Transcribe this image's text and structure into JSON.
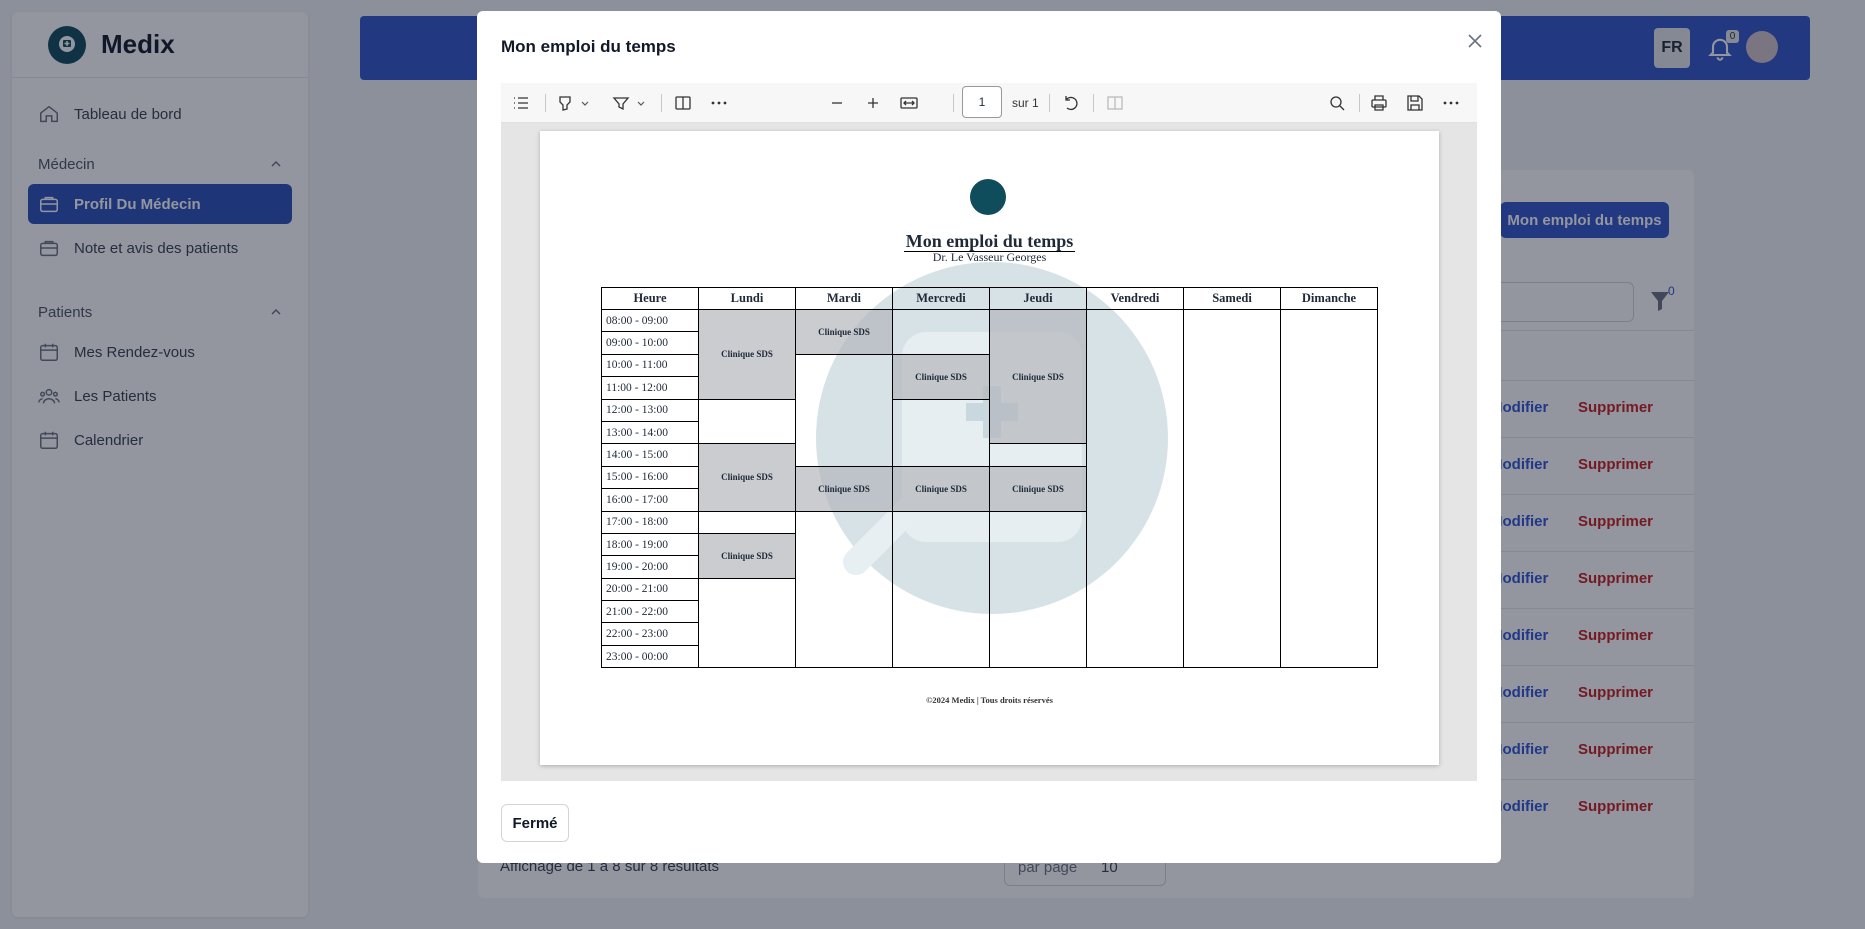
{
  "brand": {
    "name": "Medix"
  },
  "sidebar": {
    "dashboard": "Tableau de bord",
    "sections": [
      {
        "label": "Médecin",
        "items": [
          "Profil Du Médecin",
          "Note et avis des patients"
        ]
      },
      {
        "label": "Patients",
        "items": [
          "Mes Rendez-vous",
          "Les Patients",
          "Calendrier"
        ]
      }
    ]
  },
  "topbar": {
    "lang": "FR",
    "notif_count": "0"
  },
  "background": {
    "schedule_button": "Mon emploi du temps",
    "filter_count": "0",
    "edit_label": "Modifier",
    "delete_label": "Supprimer",
    "pagination_text": "Affichage de 1 à 8 sur 8 résultats",
    "per_page_label": "par page",
    "per_page_value": "10"
  },
  "modal": {
    "title": "Mon emploi du temps",
    "close_label": "Fermé",
    "viewer": {
      "page_number": "1",
      "page_total": "sur 1"
    },
    "document": {
      "title": "Mon emploi du temps",
      "doctor": "Dr. Le Vasseur Georges",
      "headers": [
        "Heure",
        "Lundi",
        "Mardi",
        "Mercredi",
        "Jeudi",
        "Vendredi",
        "Samedi",
        "Dimanche"
      ],
      "hours": [
        "08:00 - 09:00",
        "09:00 - 10:00",
        "10:00 - 11:00",
        "11:00 - 12:00",
        "12:00 - 13:00",
        "13:00 - 14:00",
        "14:00 - 15:00",
        "15:00 - 16:00",
        "16:00 - 17:00",
        "17:00 - 18:00",
        "18:00 - 19:00",
        "19:00 - 20:00",
        "20:00 - 21:00",
        "21:00 - 22:00",
        "22:00 - 23:00",
        "23:00 - 00:00"
      ],
      "slot_label": "Clinique SDS",
      "footer": "©2024 Medix | Tous droits réservés"
    }
  }
}
